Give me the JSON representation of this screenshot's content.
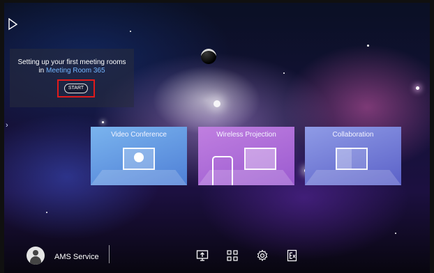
{
  "setup": {
    "line1": "Setting up your first meeting rooms",
    "line2_prefix": "in",
    "room_name": "Meeting Room 365",
    "start_label": "START"
  },
  "cards": [
    {
      "title": "Video Conference"
    },
    {
      "title": "Wireless Projection"
    },
    {
      "title": "Collaboration"
    }
  ],
  "bottom_bar": {
    "user_name": "AMS Service",
    "icons": [
      "screen-share-icon",
      "apps-grid-icon",
      "settings-gear-icon",
      "exit-icon"
    ]
  },
  "colors": {
    "highlight": "#e01b1b",
    "room_link": "#74b6ff"
  }
}
